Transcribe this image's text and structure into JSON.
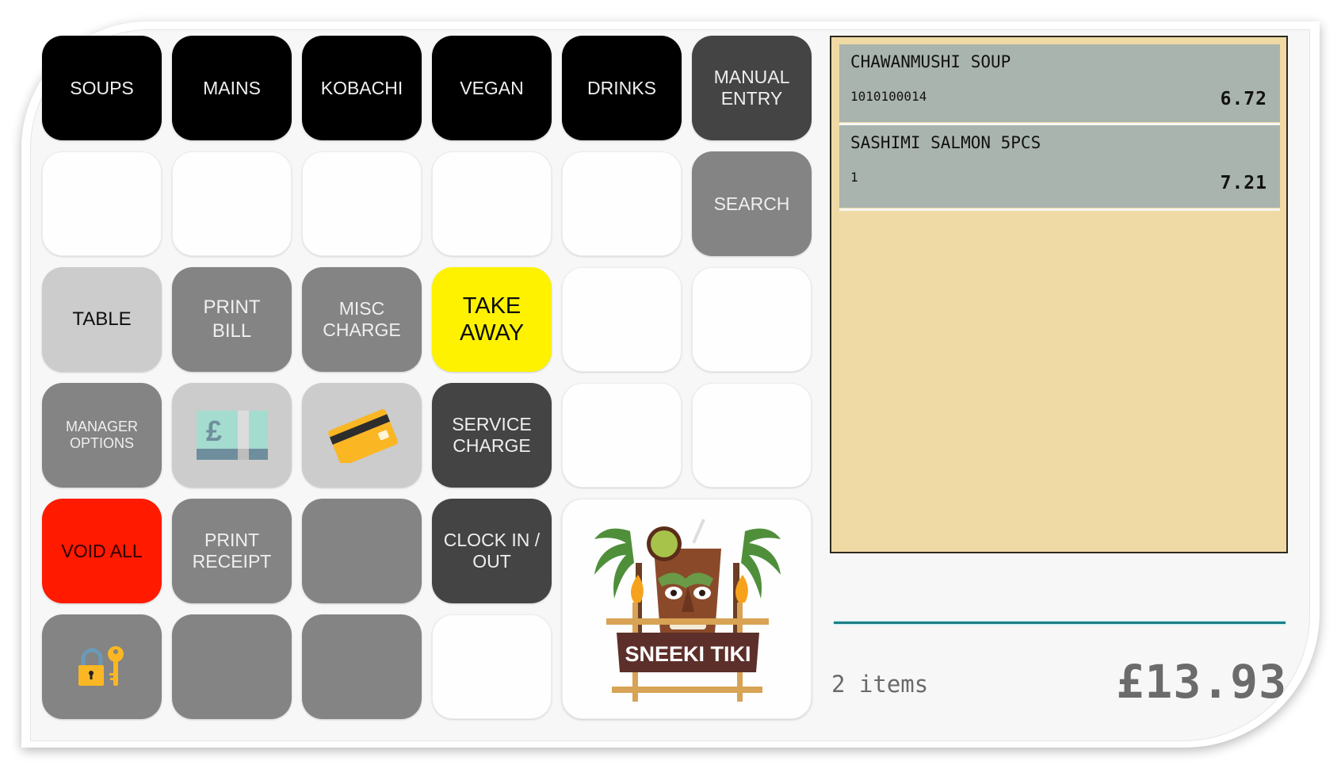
{
  "grid": {
    "row1": [
      {
        "label": "SOUPS"
      },
      {
        "label": "MAINS"
      },
      {
        "label": "KOBACHI"
      },
      {
        "label": "VEGAN"
      },
      {
        "label": "DRINKS"
      },
      {
        "label": "MANUAL\nENTRY"
      }
    ],
    "row2": [
      {
        "label": "SEARCH"
      }
    ],
    "row3": [
      {
        "label": "TABLE"
      },
      {
        "label": "PRINT\nBILL"
      },
      {
        "label": "MISC\nCHARGE"
      },
      {
        "label": "TAKE\nAWAY"
      }
    ],
    "row4": [
      {
        "label": "MANAGER\nOPTIONS"
      },
      {
        "icon": "cash-pound-icon"
      },
      {
        "icon": "credit-card-icon"
      },
      {
        "label": "SERVICE\nCHARGE"
      }
    ],
    "row5": [
      {
        "label": "VOID ALL"
      },
      {
        "label": "PRINT\nRECEIPT"
      },
      {
        "label": ""
      },
      {
        "label": "CLOCK IN /\nOUT"
      }
    ],
    "row6": [
      {
        "icon": "lock-key-icon"
      }
    ],
    "logo": {
      "text": "SNEEKI TIKI"
    }
  },
  "receipt": {
    "items": [
      {
        "name": "CHAWANMUSHI SOUP",
        "code": "1010100014",
        "price": "6.72"
      },
      {
        "name": "SASHIMI SALMON 5PCS",
        "code": "1",
        "price": "7.21"
      }
    ],
    "item_count": "2 items",
    "total": "£13.93"
  },
  "colors": {
    "category": "#000000",
    "action_dark": "#434443",
    "action_gray": "#838483",
    "action_light": "#cbcccb",
    "takeaway": "#fff200",
    "void": "#ff1a00",
    "receipt_bg": "#efd9a5",
    "receipt_row": "#aab4ae",
    "divider": "#1d7e86"
  }
}
